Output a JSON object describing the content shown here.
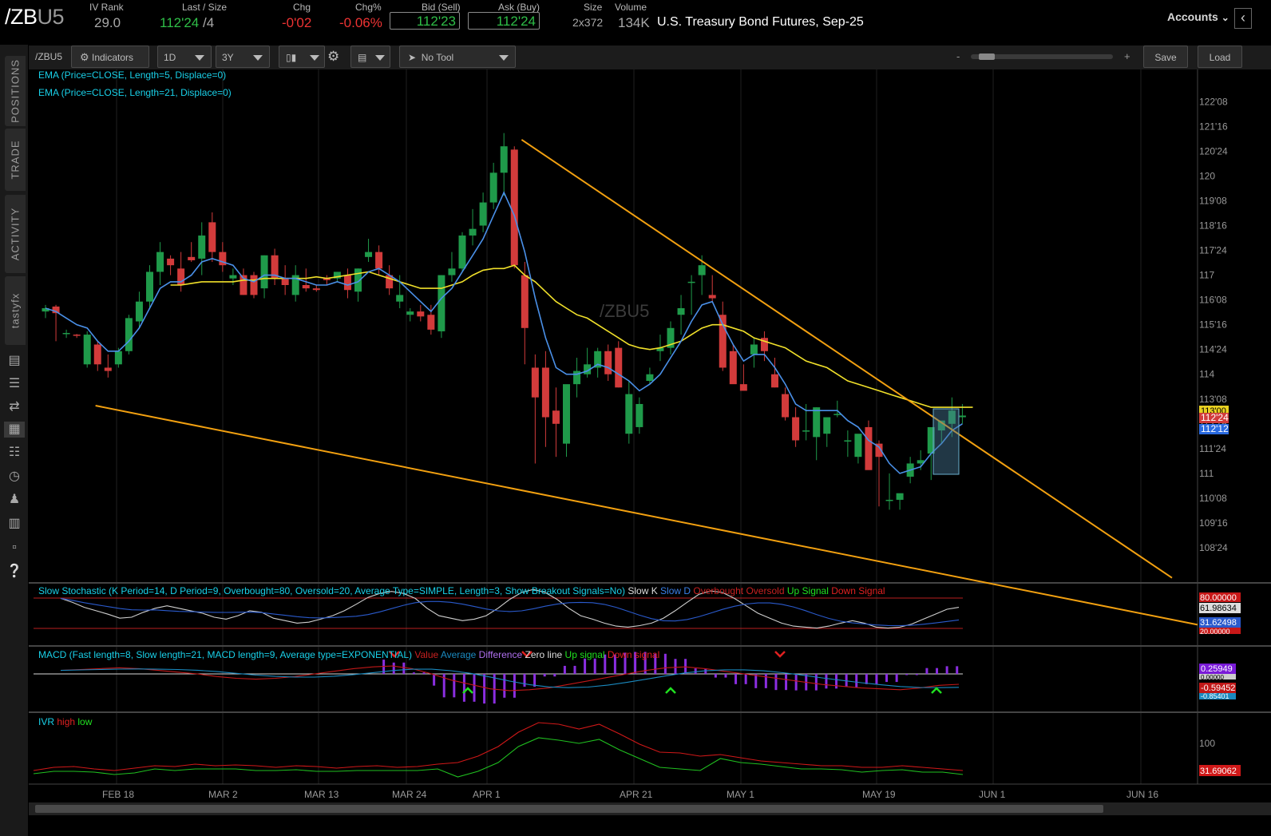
{
  "quote": {
    "symbol_prefix": "/ZB",
    "symbol_suffix": "U5",
    "iv_rank_label": "IV Rank",
    "iv_rank": "29.0",
    "last_size_label": "Last / Size",
    "last": "112'24",
    "size": "/4",
    "chg_label": "Chg",
    "chg": "-0'02",
    "chgpct_label": "Chg%",
    "chgpct": "-0.06%",
    "bid_label": "Bid (Sell)",
    "bid": "112'23",
    "ask_label": "Ask (Buy)",
    "ask": "112'24",
    "size2_label": "Size",
    "size2": "2x372",
    "volume_label": "Volume",
    "volume": "134K",
    "description": "U.S. Treasury Bond Futures, Sep-25",
    "accounts": "Accounts"
  },
  "side_tabs": [
    "POSITIONS",
    "TRADE",
    "ACTIVITY",
    "tastyfx"
  ],
  "side_icons": [
    "news-icon",
    "list-icon",
    "flow-icon",
    "chart-icon",
    "grid-icon",
    "gauge-icon",
    "people-icon",
    "calendar-icon",
    "fx-icon",
    "help-icon"
  ],
  "toolbar": {
    "symbol": "/ZBU5",
    "indicators": "Indicators",
    "aggregation": "1D",
    "timeframe": "3Y",
    "tool": "No Tool",
    "zoom_minus": "-",
    "zoom_plus": "+",
    "save": "Save",
    "load": "Load"
  },
  "studies": {
    "ema5": "EMA (Price=CLOSE, Length=5, Displace=0)",
    "ema21": "EMA (Price=CLOSE, Length=21, Displace=0)",
    "watermark": "/ZBU5",
    "stoch_label": "Slow Stochastic (K Period=14, D Period=9, Overbought=80, Oversold=20, Average Type=SIMPLE, Length=3, Show Breakout Signals=No)",
    "stoch_legend": [
      "Slow K",
      "Slow D",
      "Overbought",
      "Oversold",
      "Up Signal",
      "Down Signal"
    ],
    "macd_label": "MACD (Fast length=8, Slow length=21, MACD length=9, Average type=EXPONENTIAL)",
    "macd_legend": [
      "Value",
      "Average",
      "Difference",
      "Zero line",
      "Up signal",
      "Down signal"
    ],
    "ivr_label": "IVR",
    "ivr_legend": [
      "high",
      "low"
    ]
  },
  "price_axis": [
    "122'08",
    "121'16",
    "120'24",
    "120",
    "119'08",
    "118'16",
    "117'24",
    "117",
    "116'08",
    "115'16",
    "114'24",
    "114",
    "113'08",
    "112'16",
    "111'24",
    "111",
    "110'08",
    "109'16",
    "108'24"
  ],
  "price_badges": {
    "yellow": "113'00",
    "red": "112'24",
    "blue": "112'12"
  },
  "stoch_badges": {
    "overbought": "80.00000",
    "value1": "61.98634",
    "value2": "31.62498",
    "oversold": "20.00000"
  },
  "macd_badges": {
    "diff": "0.25949",
    "zero": "0.00000",
    "value": "-0.59452",
    "avg": "-0.85401"
  },
  "ivr_axis": "100",
  "ivr_badge": "31.69062",
  "date_axis": [
    "FEB 18",
    "MAR 2",
    "MAR 13",
    "MAR 24",
    "APR 1",
    "APR 21",
    "MAY 1",
    "MAY 19",
    "JUN 1",
    "JUN 16"
  ],
  "colors": {
    "up": "#1f9a4a",
    "down": "#d23b3b",
    "ema5": "#4a90e8",
    "ema21": "#f0e02a",
    "trendline": "#f2a010",
    "background": "#000000"
  },
  "chart_data": {
    "type": "candlestick",
    "title": "/ZBU5",
    "x_unit": "trading day index",
    "candles": [
      [
        115.9,
        116.1,
        115.7,
        116.0
      ],
      [
        116.05,
        116.1,
        115.0,
        115.85
      ],
      [
        115.25,
        115.35,
        115.1,
        115.25
      ],
      [
        115.2,
        115.22,
        115.1,
        115.18
      ],
      [
        114.3,
        115.3,
        114.2,
        115.2
      ],
      [
        114.9,
        115.0,
        114.1,
        114.3
      ],
      [
        114.2,
        114.6,
        113.9,
        114.1
      ],
      [
        114.3,
        114.8,
        114.2,
        114.7
      ],
      [
        114.7,
        115.8,
        114.6,
        115.7
      ],
      [
        115.6,
        116.5,
        115.4,
        116.2
      ],
      [
        116.2,
        117.3,
        116.0,
        117.1
      ],
      [
        117.1,
        118.0,
        116.7,
        117.7
      ],
      [
        117.5,
        117.6,
        117.0,
        117.3
      ],
      [
        117.2,
        117.7,
        116.5,
        116.7
      ],
      [
        117.55,
        118.0,
        117.4,
        117.45
      ],
      [
        117.5,
        118.6,
        117.0,
        118.2
      ],
      [
        118.6,
        118.9,
        117.4,
        117.7
      ],
      [
        117.7,
        118.0,
        117.1,
        117.3
      ],
      [
        116.9,
        117.2,
        116.7,
        117.0
      ],
      [
        117.0,
        117.2,
        116.4,
        116.4
      ],
      [
        117.0,
        117.1,
        116.3,
        116.4
      ],
      [
        116.6,
        117.6,
        116.3,
        117.6
      ],
      [
        117.6,
        117.8,
        116.7,
        116.9
      ],
      [
        116.9,
        117.3,
        116.4,
        116.7
      ],
      [
        116.4,
        117.3,
        116.2,
        117.0
      ],
      [
        116.7,
        117.2,
        116.5,
        116.6
      ],
      [
        116.6,
        116.7,
        116.5,
        116.55
      ],
      [
        116.9,
        117.0,
        116.7,
        116.85
      ],
      [
        116.9,
        117.1,
        116.8,
        117.1
      ],
      [
        117.0,
        117.2,
        116.3,
        116.55
      ],
      [
        116.5,
        117.2,
        116.2,
        117.2
      ],
      [
        117.55,
        118.1,
        117.4,
        117.7
      ],
      [
        117.7,
        117.9,
        117.0,
        117.2
      ],
      [
        117.0,
        117.3,
        116.4,
        116.6
      ],
      [
        116.2,
        117.0,
        116.0,
        116.4
      ],
      [
        115.8,
        116.0,
        115.6,
        115.9
      ],
      [
        115.9,
        116.1,
        115.6,
        115.75
      ],
      [
        115.8,
        116.1,
        115.2,
        115.35
      ],
      [
        115.3,
        117.0,
        115.1,
        117.0
      ],
      [
        117.0,
        117.7,
        116.8,
        117.2
      ],
      [
        117.2,
        118.3,
        117.1,
        118.2
      ],
      [
        118.2,
        119.0,
        117.9,
        118.4
      ],
      [
        118.5,
        119.5,
        118.3,
        119.2
      ],
      [
        119.2,
        120.4,
        119.0,
        120.1
      ],
      [
        120.1,
        121.3,
        119.4,
        120.9
      ],
      [
        120.8,
        120.9,
        117.2,
        117.3
      ],
      [
        117.0,
        117.4,
        114.3,
        115.4
      ],
      [
        114.2,
        114.6,
        111.3,
        113.3
      ],
      [
        114.2,
        114.7,
        111.8,
        112.7
      ],
      [
        112.9,
        113.6,
        111.5,
        112.5
      ],
      [
        111.9,
        112.7,
        111.5,
        113.7
      ],
      [
        113.7,
        114.5,
        113.3,
        114.1
      ],
      [
        114.0,
        114.8,
        113.9,
        114.3
      ],
      [
        114.2,
        114.8,
        113.9,
        114.7
      ],
      [
        114.7,
        114.9,
        113.8,
        114.0
      ],
      [
        114.8,
        115.0,
        113.6,
        113.6
      ],
      [
        112.2,
        113.8,
        111.9,
        113.4
      ],
      [
        112.4,
        113.3,
        112.2,
        113.1
      ],
      [
        113.8,
        114.2,
        113.7,
        114.0
      ],
      [
        114.7,
        115.2,
        114.4,
        114.8
      ],
      [
        114.8,
        115.6,
        114.6,
        115.4
      ],
      [
        115.8,
        116.4,
        115.2,
        116.0
      ],
      [
        116.8,
        117.0,
        115.8,
        116.8
      ],
      [
        117.0,
        117.6,
        116.4,
        117.3
      ],
      [
        116.4,
        117.0,
        116.2,
        116.3
      ],
      [
        115.8,
        116.2,
        114.1,
        114.2
      ],
      [
        114.7,
        114.9,
        113.9,
        113.7
      ],
      [
        113.7,
        114.3,
        113.6,
        113.5
      ],
      [
        114.6,
        115.1,
        114.2,
        114.9
      ],
      [
        115.1,
        115.3,
        114.4,
        114.7
      ],
      [
        114.0,
        114.5,
        113.6,
        113.6
      ],
      [
        113.4,
        113.6,
        112.6,
        112.7
      ],
      [
        112.7,
        113.0,
        111.8,
        112.0
      ],
      [
        112.3,
        113.1,
        112.0,
        112.3
      ],
      [
        112.1,
        113.0,
        111.4,
        113.0
      ],
      [
        112.2,
        112.6,
        111.8,
        112.7
      ],
      [
        112.8,
        113.2,
        112.7,
        112.8
      ],
      [
        112.0,
        112.3,
        111.5,
        112.0
      ],
      [
        111.5,
        111.8,
        111.3,
        112.2
      ],
      [
        112.4,
        112.6,
        111.5,
        111.1
      ],
      [
        111.9,
        112.0,
        110.0,
        111.5
      ],
      [
        110.2,
        111.0,
        109.9,
        110.2
      ],
      [
        110.2,
        110.3,
        109.9,
        110.4
      ],
      [
        110.9,
        111.5,
        110.7,
        111.3
      ],
      [
        111.3,
        111.7,
        111.1,
        111.4
      ],
      [
        111.6,
        112.4,
        110.8,
        112.4
      ],
      [
        112.3,
        112.5,
        111.9,
        112.6
      ],
      [
        112.5,
        113.3,
        112.1,
        112.9
      ],
      [
        112.7,
        113.1,
        112.5,
        112.75
      ]
    ],
    "ema5": [
      116.0,
      115.9,
      115.7,
      115.5,
      115.4,
      115.0,
      114.7,
      114.7,
      115.0,
      115.4,
      116.0,
      116.6,
      116.8,
      116.8,
      117.0,
      117.4,
      117.5,
      117.4,
      117.3,
      116.9,
      116.8,
      117.0,
      117.0,
      116.9,
      116.9,
      116.8,
      116.7,
      116.7,
      116.8,
      116.7,
      116.8,
      117.1,
      117.2,
      117.0,
      116.8,
      116.5,
      116.2,
      115.9,
      116.3,
      116.6,
      117.1,
      117.6,
      118.1,
      118.8,
      119.5,
      118.8,
      117.7,
      116.3,
      115.1,
      114.2,
      114.0,
      114.0,
      114.1,
      114.3,
      114.2,
      114.0,
      113.8,
      113.5,
      113.7,
      114.0,
      114.5,
      115.0,
      115.6,
      116.1,
      116.2,
      115.5,
      114.9,
      114.4,
      114.6,
      114.6,
      114.2,
      113.7,
      113.1,
      112.9,
      112.9,
      112.9,
      112.9,
      112.6,
      112.4,
      112.0,
      111.8,
      111.3,
      111.0,
      111.1,
      111.2,
      111.6,
      111.9,
      112.3,
      112.5
    ],
    "ema21_start_index": 12,
    "ema21": [
      116.7,
      116.7,
      116.75,
      116.8,
      116.8,
      116.8,
      116.8,
      116.85,
      116.85,
      116.9,
      116.9,
      116.9,
      116.9,
      116.9,
      116.95,
      116.9,
      116.95,
      117.0,
      117.05,
      117.1,
      117.0,
      116.9,
      116.8,
      116.7,
      116.6,
      116.6,
      116.6,
      116.7,
      116.8,
      117.0,
      117.15,
      117.2,
      117.2,
      117.3,
      117.0,
      116.8,
      116.5,
      116.2,
      116.0,
      115.8,
      115.7,
      115.5,
      115.3,
      115.1,
      114.9,
      114.8,
      114.75,
      114.8,
      114.9,
      115.0,
      115.2,
      115.4,
      115.5,
      115.5,
      115.4,
      115.3,
      115.1,
      115.0,
      114.9,
      114.8,
      114.6,
      114.4,
      114.3,
      114.2,
      114.0,
      113.8,
      113.7,
      113.6,
      113.5,
      113.4,
      113.3,
      113.2,
      113.1,
      113.0,
      113.0,
      113.0,
      113.0,
      113.0
    ],
    "trendlines": [
      {
        "from": [
          3,
          113.0
        ],
        "to": [
          1830,
          107.9
        ]
      },
      {
        "from": [
          44.6,
          121.0
        ],
        "to": [
          92.8,
          108.3
        ]
      }
    ],
    "price_axis_range": [
      108.0,
      122.5
    ],
    "stochastic": {
      "overbought": 80,
      "oversold": 20,
      "slow_k_last": 61.98634,
      "slow_d_last": 31.62498,
      "range": [
        0,
        100
      ]
    },
    "macd": {
      "value_last": -0.59452,
      "average_last": -0.85401,
      "difference_last": 0.25949
    }
  }
}
